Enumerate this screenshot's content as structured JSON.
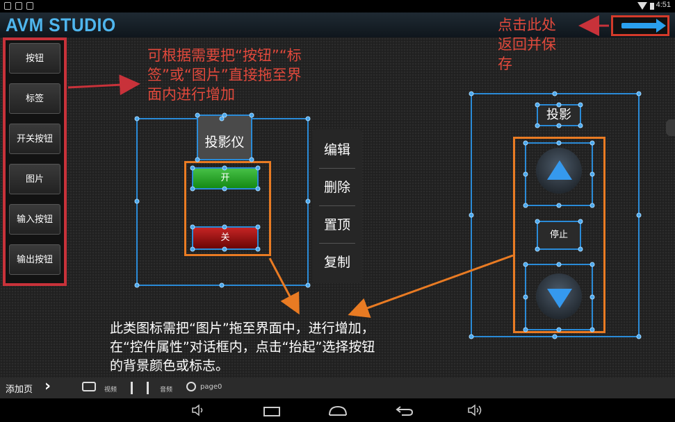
{
  "status_bar": {
    "time": "4:51"
  },
  "app": {
    "title": "AVM STUDIO"
  },
  "palette": {
    "items": [
      "按钮",
      "标签",
      "开关按钮",
      "图片",
      "输入按钮",
      "输出按钮"
    ]
  },
  "annotations": {
    "drag_hint": "可根据需要把“按钮”“标签”或“图片”直接拖至界面内进行增加",
    "drag_hint_lines": [
      "可根据需要把“按钮”“标",
      "签”或“图片”直接拖至界",
      "面内进行增加"
    ],
    "save_hint_lines": [
      "点击此处",
      "返回并保",
      "存"
    ],
    "image_hint_lines": [
      "此类图标需把“图片”拖至界面中，进行增加，",
      "在“控件属性”对话框内，点击“抬起”选择按钮",
      "的背景颜色或标志。"
    ]
  },
  "projector_group": {
    "label": "投影仪",
    "on_button": "开",
    "off_button": "关"
  },
  "context_menu": {
    "items": [
      "编辑",
      "删除",
      "置顶",
      "复制"
    ]
  },
  "screen_group": {
    "label": "投影",
    "stop_button": "停止"
  },
  "bottom_bar": {
    "add_page": "添加页",
    "video": "视频",
    "audio": "音频",
    "page": "page0"
  },
  "colors": {
    "accent": "#2a8bd8",
    "annotation_red": "#e1493c",
    "annotation_orange": "#e97b23",
    "title_blue": "#4fb6ee"
  }
}
